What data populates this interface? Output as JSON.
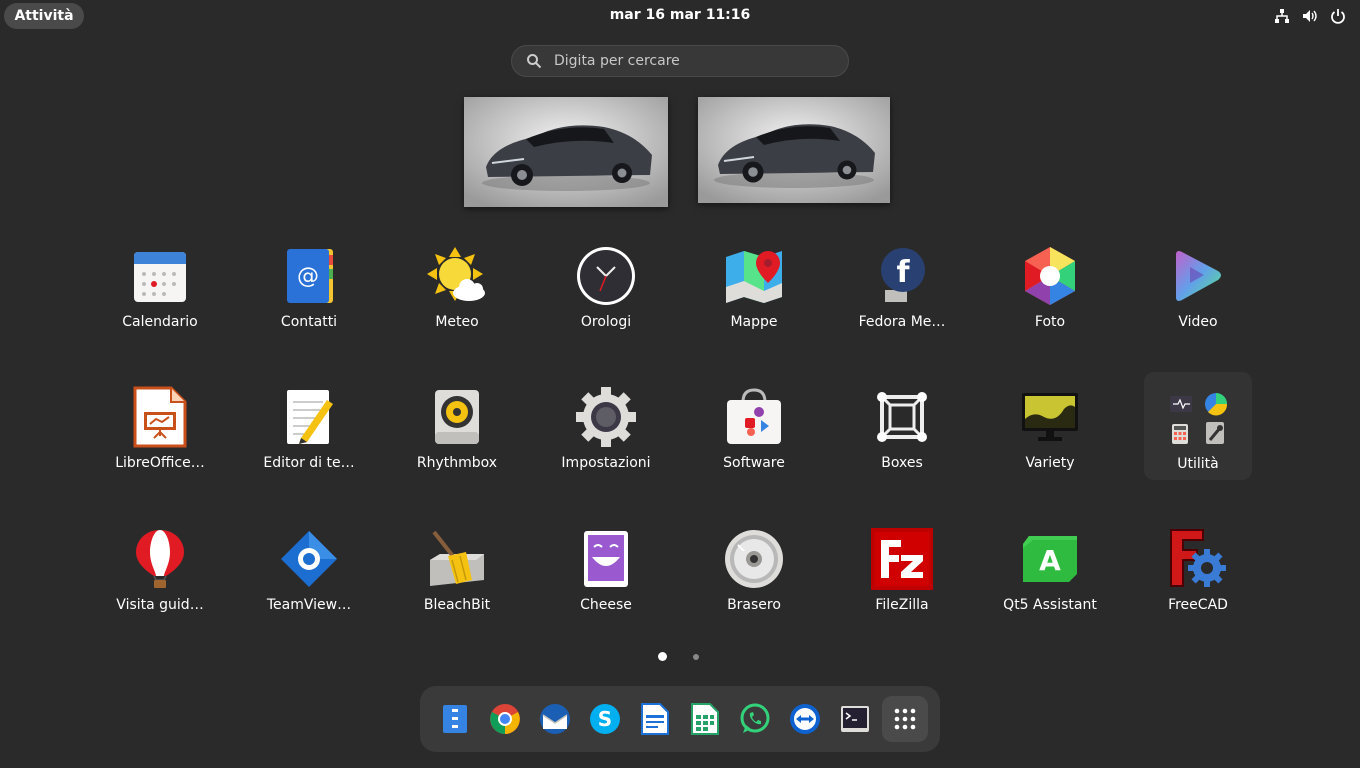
{
  "topbar": {
    "activities_label": "Attività",
    "clock": "mar 16 mar  11:16",
    "system_icons": [
      "network-icon",
      "volume-icon",
      "power-icon"
    ]
  },
  "search": {
    "placeholder": "Digita per cercare"
  },
  "workspaces": [
    "workspace-1",
    "workspace-2"
  ],
  "apps": [
    {
      "label": "Calendario"
    },
    {
      "label": "Contatti"
    },
    {
      "label": "Meteo"
    },
    {
      "label": "Orologi"
    },
    {
      "label": "Mappe"
    },
    {
      "label": "Fedora Me…"
    },
    {
      "label": "Foto"
    },
    {
      "label": "Video"
    },
    {
      "label": "LibreOffice…"
    },
    {
      "label": "Editor di te…"
    },
    {
      "label": "Rhythmbox"
    },
    {
      "label": "Impostazioni"
    },
    {
      "label": "Software"
    },
    {
      "label": "Boxes"
    },
    {
      "label": "Variety"
    },
    {
      "label": "Utilità"
    },
    {
      "label": "Visita guid…"
    },
    {
      "label": "TeamView…"
    },
    {
      "label": "BleachBit"
    },
    {
      "label": "Cheese"
    },
    {
      "label": "Brasero"
    },
    {
      "label": "FileZilla"
    },
    {
      "label": "Qt5 Assistant"
    },
    {
      "label": "FreeCAD"
    }
  ],
  "pager": {
    "pages": 2,
    "current": 1
  },
  "dock": [
    "files-icon",
    "chrome-icon",
    "thunderbird-icon",
    "skype-icon",
    "writer-icon",
    "calc-icon",
    "whatsapp-icon",
    "teamviewer-icon",
    "terminal-icon",
    "show-apps-icon"
  ]
}
